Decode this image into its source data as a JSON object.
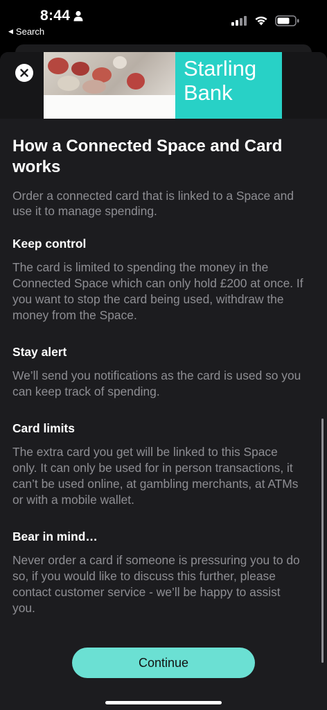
{
  "status_bar": {
    "time": "8:44",
    "back_app": "Search"
  },
  "hero": {
    "brand_line1": "Starling",
    "brand_line2": "Bank",
    "brand_color": "#28d1c6"
  },
  "content": {
    "title": "How a Connected Space and Card works",
    "intro": "Order a connected card that is linked to a Space and use it to manage spending.",
    "sections": [
      {
        "heading": "Keep control",
        "body": "The card is limited to spending the money in the Connected Space which can only hold £200 at once. If you want to stop the card being used, withdraw the money from the Space."
      },
      {
        "heading": "Stay alert",
        "body": "We’ll send you notifications as the card is used so you can keep track of spending."
      },
      {
        "heading": "Card limits",
        "body": "The extra card you get will be linked to this Space only. It can only be used for in person transactions, it can’t be used online, at gambling merchants, at ATMs or with a mobile wallet."
      },
      {
        "heading": "Bear in mind…",
        "body": "Never order a card if someone is pressuring you to do so, if you would like to discuss this further, please contact customer service - we’ll be happy to assist you."
      }
    ]
  },
  "actions": {
    "continue_label": "Continue",
    "accent_color": "#6be0d3"
  },
  "icons": {
    "close": "close-icon",
    "signal": "signal-icon",
    "wifi": "wifi-icon",
    "battery": "battery-icon"
  }
}
